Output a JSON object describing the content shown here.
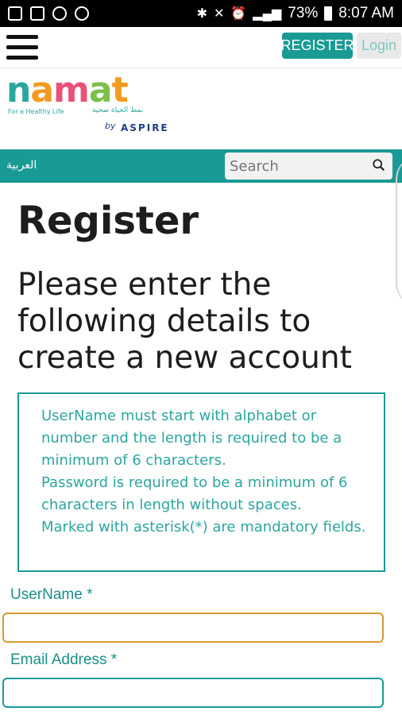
{
  "status_bar": {
    "battery": "73%",
    "time": "8:07 AM",
    "left_icons": [
      "photo-icon",
      "gallery-icon",
      "instagram-icon",
      "no-sim-icon"
    ],
    "right_icons": [
      "bluetooth-icon",
      "mute-icon",
      "alarm-icon",
      "4g-icon",
      "signal-icon",
      "battery-icon"
    ]
  },
  "header": {
    "register_label": "REGISTER",
    "login_label": "Login",
    "accent": "#1a9a94"
  },
  "logo": {
    "letters": [
      "n",
      "a",
      "m",
      "a",
      "t"
    ],
    "tagline": "For a Healthy Life",
    "arabic": "نمط الحياة صحية",
    "by": "by",
    "brand": "ASPIRE"
  },
  "nav": {
    "arabic_link": "العربية",
    "search_placeholder": "Search"
  },
  "main": {
    "title": "Register",
    "subtitle": "Please enter the following details to create a new account",
    "info_lines": [
      "UserName must start with alphabet or number and the length is required to be a minimum of 6 characters.",
      "Password is required to be a minimum of 6 characters in length without spaces.",
      "Marked with asterisk(*) are mandatory fields."
    ]
  },
  "form": {
    "username_label": "UserName *",
    "username_value": "",
    "email_label": "Email Address *",
    "email_value": ""
  }
}
